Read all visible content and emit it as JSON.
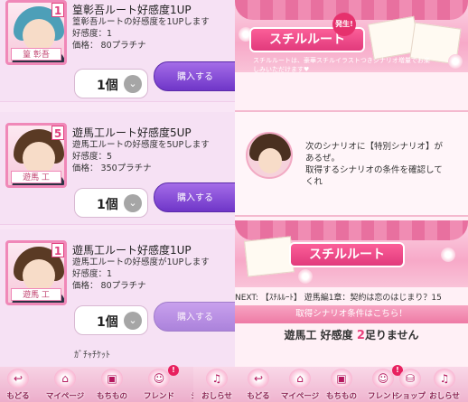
{
  "shop": {
    "items": [
      {
        "num": "1",
        "tag": "篁 彰吾",
        "title": "篁彰吾ルート好感度1UP",
        "desc": "篁彰吾ルートの好感度を1UPします",
        "effect": "好感度：1",
        "price": "価格： 80プラチナ",
        "qty": "1個",
        "buy": "購入する",
        "hair": "#4d9fb8"
      },
      {
        "num": "5",
        "tag": "遊馬 工",
        "title": "遊馬工ルート好感度5UP",
        "desc": "遊馬工ルートの好感度を5UPします",
        "effect": "好感度：5",
        "price": "価格： 350プラチナ",
        "qty": "1個",
        "buy": "購入する",
        "hair": "#5a3a24"
      },
      {
        "num": "1",
        "tag": "遊馬 工",
        "title": "遊馬工ルート好感度1UP",
        "desc": "遊馬工ルートの好感度が1UPします",
        "effect": "好感度：1",
        "price": "価格： 80プラチナ",
        "qty": "1個",
        "buy": "購入する",
        "hair": "#5a3a24"
      }
    ],
    "partial_label": "ｶﾞﾁｬﾁｹｯﾄ"
  },
  "scenario": {
    "banner_top": {
      "title": "スチルルート",
      "badge": "発生!",
      "subtext": "スチルルートは、豪華スチルイラストつきシナリオ増量でお楽しみいただけます♥"
    },
    "message": [
      "次のシナリオに【特別シナリオ】が",
      "あるぜ。",
      "取得するシナリオの条件を確認して",
      "くれ"
    ],
    "banner_bottom": {
      "title": "スチルルート"
    },
    "next": "NEXT: 【ｽﾁﾙﾙｰﾄ】 遊馬編1章：契約は恋のはじまり？15",
    "condition_button": "取得シナリオ条件はこちら！",
    "shortage": {
      "prefix": "遊馬工 好感度 ",
      "value": "2",
      "suffix": "足りません"
    }
  },
  "footer": {
    "left": [
      {
        "label": "もどる",
        "icon": "↩",
        "icon_name": "back-icon",
        "notif": ""
      },
      {
        "label": "マイページ",
        "icon": "⌂",
        "icon_name": "home-icon",
        "notif": ""
      },
      {
        "label": "もちもの",
        "icon": "▣",
        "icon_name": "bag-icon",
        "notif": ""
      },
      {
        "label": "フレンド",
        "icon": "☺",
        "icon_name": "friend-icon",
        "notif": "!"
      },
      {
        "label": "ショップ",
        "icon": "⛁",
        "icon_name": "shop-icon",
        "notif": ""
      }
    ],
    "right": [
      {
        "label": "おしらせ",
        "icon": "♫",
        "icon_name": "bell-icon",
        "notif": ""
      },
      {
        "label": "もどる",
        "icon": "↩",
        "icon_name": "back-icon",
        "notif": ""
      },
      {
        "label": "マイページ",
        "icon": "⌂",
        "icon_name": "home-icon",
        "notif": ""
      },
      {
        "label": "もちもの",
        "icon": "▣",
        "icon_name": "bag-icon",
        "notif": ""
      },
      {
        "label": "フレンド",
        "icon": "☺",
        "icon_name": "friend-icon",
        "notif": "!"
      },
      {
        "label": "ショップ",
        "icon": "⛁",
        "icon_name": "shop-icon",
        "notif": ""
      }
    ],
    "end": {
      "label": "おしらせ",
      "icon": "♫",
      "icon_name": "bell-icon",
      "notif": ""
    }
  }
}
